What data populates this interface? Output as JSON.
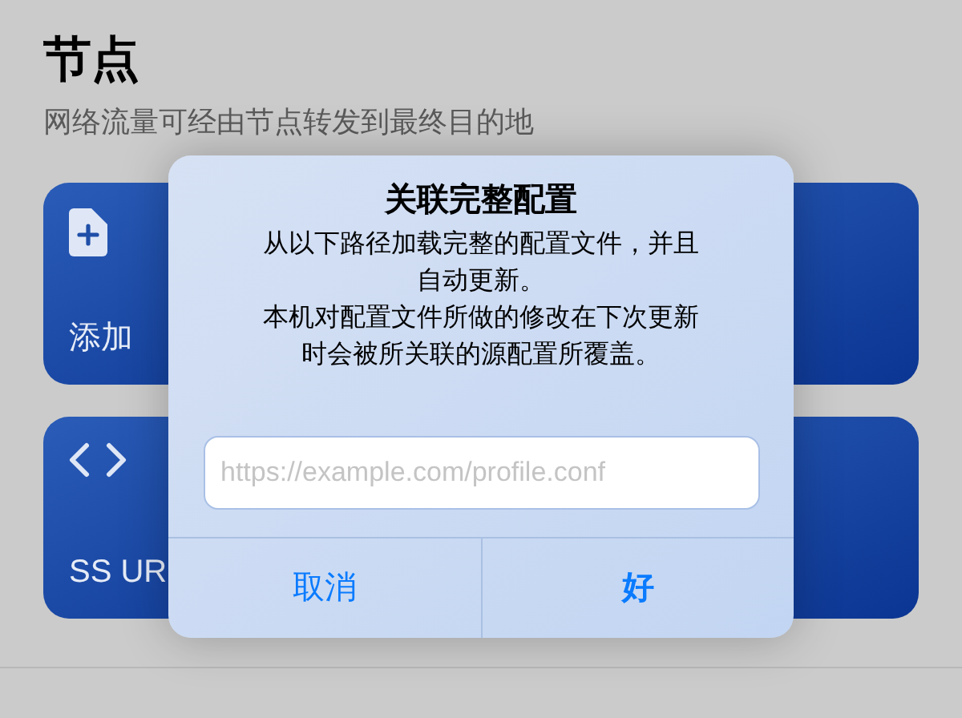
{
  "page": {
    "title": "节点",
    "subtitle": "网络流量可经由节点转发到最终目的地"
  },
  "cards": [
    {
      "kind": "add",
      "label": "添加"
    },
    {
      "kind": "blank"
    },
    {
      "kind": "code",
      "label": "SS UR"
    },
    {
      "kind": "blank"
    }
  ],
  "dialog": {
    "title": "关联完整配置",
    "message": [
      "从以下路径加载完整的配置文件，并且自动更新。",
      "本机对配置文件所做的修改在下次更新时会被所关联的源配置所覆盖。"
    ],
    "field": {
      "placeholder": "https://example.com/profile.conf"
    },
    "buttons": [
      {
        "label": "取消",
        "kind": "cancel"
      },
      {
        "label": "好",
        "kind": "default"
      }
    ]
  }
}
